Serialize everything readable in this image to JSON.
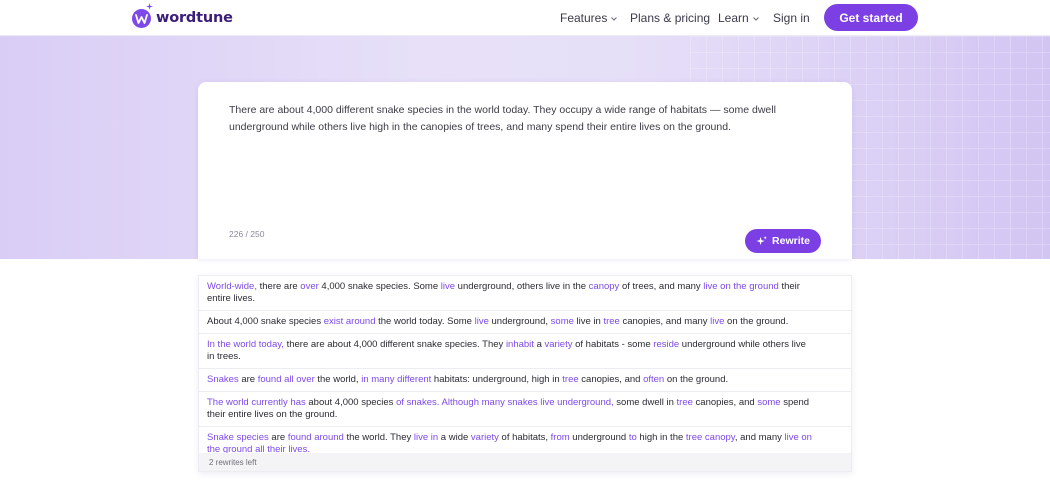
{
  "nav": {
    "logo_text": "wordtune",
    "features": "Features",
    "plans": "Plans & pricing",
    "learn": "Learn",
    "signin": "Sign in",
    "get_started": "Get started"
  },
  "editor": {
    "text": "There are about 4,000 different snake species in the world today. They occupy a wide range of habitats — some dwell underground while others live high in the canopies of trees, and many spend their entire lives on the ground.",
    "char_count": "226 / 250",
    "rewrite_label": "Rewrite"
  },
  "results": {
    "rewrites_left": "2 rewrites left",
    "items": [
      [
        [
          "World-wide,",
          true
        ],
        [
          " there are ",
          false
        ],
        [
          "over",
          true
        ],
        [
          " 4,000 snake species. Some ",
          false
        ],
        [
          "live",
          true
        ],
        [
          " underground, others live in the ",
          false
        ],
        [
          "canopy",
          true
        ],
        [
          " of trees, and many ",
          false
        ],
        [
          "live on the ground",
          true
        ],
        [
          " their entire lives.",
          false
        ]
      ],
      [
        [
          "About 4,000 snake species ",
          false
        ],
        [
          "exist around",
          true
        ],
        [
          " the world today. Some ",
          false
        ],
        [
          "live",
          true
        ],
        [
          " underground, ",
          false
        ],
        [
          "some",
          true
        ],
        [
          " live in ",
          false
        ],
        [
          "tree",
          true
        ],
        [
          " canopies, and many ",
          false
        ],
        [
          "live",
          true
        ],
        [
          " on the ground.",
          false
        ]
      ],
      [
        [
          "In the world today,",
          true
        ],
        [
          " there are about 4,000 different snake species. They ",
          false
        ],
        [
          "inhabit",
          true
        ],
        [
          " a ",
          false
        ],
        [
          "variety",
          true
        ],
        [
          " of habitats - some ",
          false
        ],
        [
          "reside",
          true
        ],
        [
          " underground while others live in trees.",
          false
        ]
      ],
      [
        [
          "Snakes",
          true
        ],
        [
          " are ",
          false
        ],
        [
          "found all over",
          true
        ],
        [
          " the world, ",
          false
        ],
        [
          "in many different",
          true
        ],
        [
          " habitats: underground, high in ",
          false
        ],
        [
          "tree",
          true
        ],
        [
          " canopies, and ",
          false
        ],
        [
          "often",
          true
        ],
        [
          " on the ground.",
          false
        ]
      ],
      [
        [
          "The world currently has",
          true
        ],
        [
          " about 4,000 species ",
          false
        ],
        [
          "of snakes.",
          true
        ],
        [
          " ",
          false
        ],
        [
          "Although many snakes live underground,",
          true
        ],
        [
          " some dwell in ",
          false
        ],
        [
          "tree",
          true
        ],
        [
          " canopies, and ",
          false
        ],
        [
          "some",
          true
        ],
        [
          " spend their entire lives on the ground.",
          false
        ]
      ],
      [
        [
          "Snake species",
          true
        ],
        [
          " are ",
          false
        ],
        [
          "found around",
          true
        ],
        [
          " the world. They ",
          false
        ],
        [
          "live in",
          true
        ],
        [
          " a wide ",
          false
        ],
        [
          "variety",
          true
        ],
        [
          " of habitats, ",
          false
        ],
        [
          "from",
          true
        ],
        [
          " underground ",
          false
        ],
        [
          "to",
          true
        ],
        [
          " high in the ",
          false
        ],
        [
          "tree canopy",
          true
        ],
        [
          ", and many ",
          false
        ],
        [
          "live on the ground all their lives.",
          true
        ]
      ]
    ]
  },
  "colors": {
    "accent": "#7b3fe4",
    "highlight": "#7d4ae8"
  }
}
